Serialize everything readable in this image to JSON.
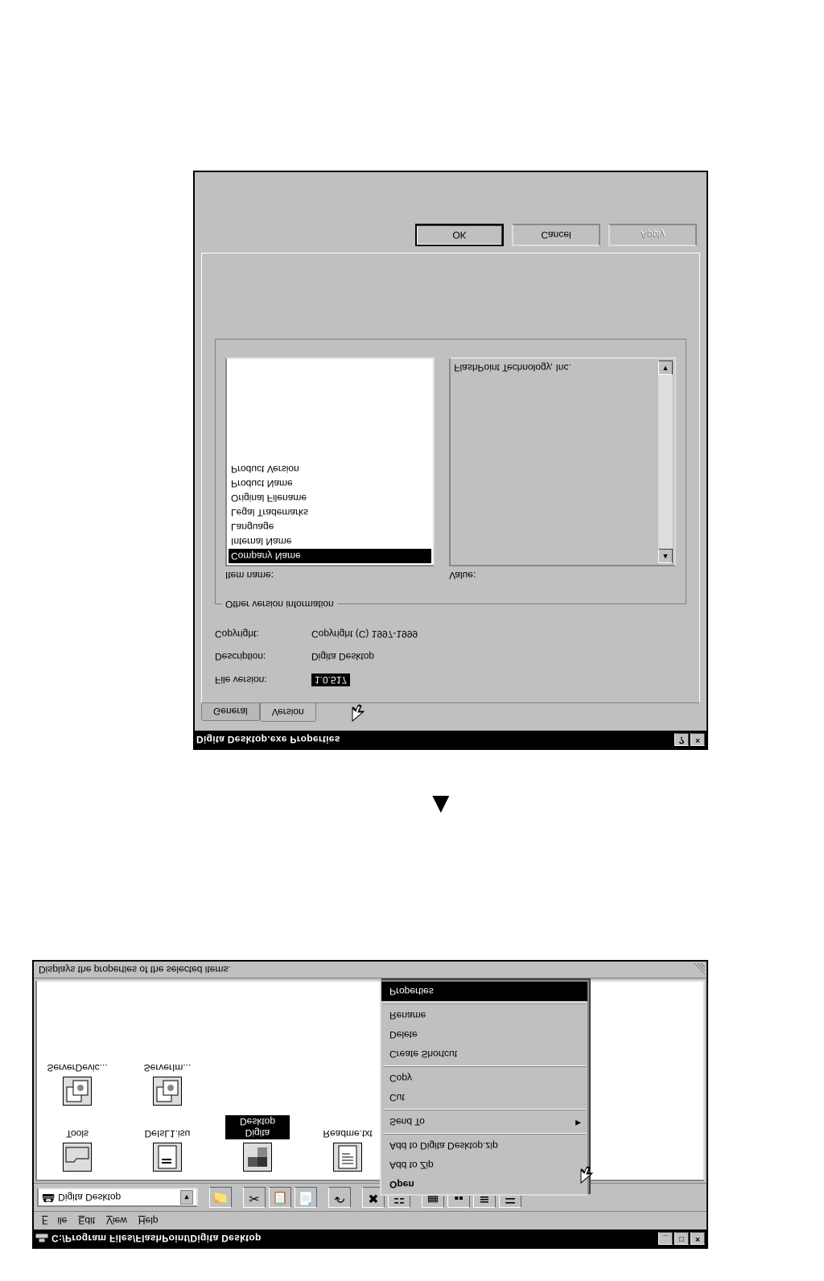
{
  "explorer": {
    "title": "C:/Program Files/FlashPoint/Digita Desktop",
    "menu": {
      "file": "File",
      "edit": "Edit",
      "view": "View",
      "help": "Help"
    },
    "address": "Digita Desktop",
    "items": [
      {
        "label": "Tools",
        "icon": "folder"
      },
      {
        "label": "DeIsL1.isu",
        "icon": "file"
      },
      {
        "label": "Digita Desktop",
        "icon": "exe",
        "selected": true,
        "net": true
      },
      {
        "label": "Readme.txt",
        "icon": "text"
      },
      {
        "label": "ServerDevic...",
        "icon": "dll"
      },
      {
        "label": "ServerIm...",
        "icon": "dll"
      }
    ],
    "status": "Displays the properties of the selected items."
  },
  "context_menu": {
    "items": [
      {
        "label": "Open",
        "bold": true
      },
      {
        "label": "Add to Zip",
        "icon": "zip"
      },
      {
        "label": "Add to Digita Desktop.zip",
        "icon": "zip"
      },
      {
        "sep": true
      },
      {
        "label": "Send To",
        "submenu": true
      },
      {
        "sep": true
      },
      {
        "label": "Cut"
      },
      {
        "label": "Copy"
      },
      {
        "sep": true
      },
      {
        "label": "Create Shortcut"
      },
      {
        "label": "Delete"
      },
      {
        "label": "Rename"
      },
      {
        "sep": true
      },
      {
        "label": "Properties",
        "selected": true
      }
    ]
  },
  "arrow_glyph": "▲",
  "dialog": {
    "title": "Digita Desktop.exe Properties",
    "tabs": {
      "general": "General",
      "version": "Version"
    },
    "file_version": {
      "label": "File version:",
      "value": "1.0.517"
    },
    "description": {
      "label": "Description:",
      "value": "Digita Desktop"
    },
    "copyright": {
      "label": "Copyright:",
      "value": "Copyright (C) 1997-1999"
    },
    "group_label": "Other version information",
    "item_name_label": "Item name:",
    "value_label": "Value:",
    "items": [
      "Company Name",
      "Internal Name",
      "Language",
      "Legal Trademarks",
      "Original Filename",
      "Product Name",
      "Product Version"
    ],
    "selected_item_index": 0,
    "value_text": "FlashPoint Technology, Inc.",
    "buttons": {
      "ok": "OK",
      "cancel": "Cancel",
      "apply": "Apply"
    }
  }
}
